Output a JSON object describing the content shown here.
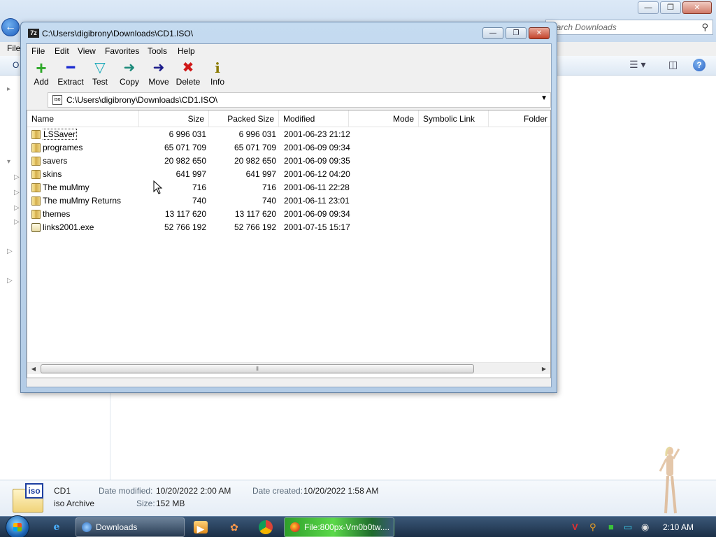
{
  "explorer": {
    "search_placeholder": "earch Downloads",
    "menu_file": "File",
    "organize": "O",
    "window_buttons": [
      "—",
      "❐",
      "✕"
    ],
    "details": {
      "name": "CD1",
      "type": "iso Archive",
      "modified_label": "Date modified:",
      "modified_value": "10/20/2022 2:00 AM",
      "created_label": "Date created:",
      "created_value": "10/20/2022 1:58 AM",
      "size_label": "Size:",
      "size_value": "152 MB",
      "icon_label": "iso"
    }
  },
  "zip": {
    "title": "C:\\Users\\digibrony\\Downloads\\CD1.ISO\\",
    "icon_text": "7z",
    "window_buttons": [
      "—",
      "❐",
      "✕"
    ],
    "menu": [
      "File",
      "Edit",
      "View",
      "Favorites",
      "Tools",
      "Help"
    ],
    "toolbar": [
      {
        "label": "Add",
        "icon": "add-icon",
        "glyph": "+",
        "color": "#2fa82a"
      },
      {
        "label": "Extract",
        "icon": "extract-icon",
        "glyph": "━",
        "color": "#1a2ad0"
      },
      {
        "label": "Test",
        "icon": "test-icon",
        "glyph": "▽",
        "color": "#18a8b8"
      },
      {
        "label": "Copy",
        "icon": "copy-icon",
        "glyph": "➜",
        "color": "#1c8a7a"
      },
      {
        "label": "Move",
        "icon": "move-icon",
        "glyph": "➜",
        "color": "#1a1a8a"
      },
      {
        "label": "Delete",
        "icon": "delete-icon",
        "glyph": "✖",
        "color": "#d01818"
      },
      {
        "label": "Info",
        "icon": "info-icon",
        "glyph": "i",
        "color": "#8a7a00"
      }
    ],
    "address_icon": "iso",
    "address_path": "C:\\Users\\digibrony\\Downloads\\CD1.ISO\\",
    "columns": [
      "Name",
      "Size",
      "Packed Size",
      "Modified",
      "Mode",
      "Symbolic Link",
      "Folder"
    ],
    "rows": [
      {
        "name": "LSSaver",
        "type": "folder",
        "size": "6 996 031",
        "packed": "6 996 031",
        "modified": "2001-06-23 21:12"
      },
      {
        "name": "programes",
        "type": "folder",
        "size": "65 071 709",
        "packed": "65 071 709",
        "modified": "2001-06-09 09:34"
      },
      {
        "name": "savers",
        "type": "folder",
        "size": "20 982 650",
        "packed": "20 982 650",
        "modified": "2001-06-09 09:35"
      },
      {
        "name": "skins",
        "type": "folder",
        "size": "641 997",
        "packed": "641 997",
        "modified": "2001-06-12 04:20"
      },
      {
        "name": "The muMmy",
        "type": "folder",
        "size": "716",
        "packed": "716",
        "modified": "2001-06-11 22:28"
      },
      {
        "name": "The muMmy Returns",
        "type": "folder",
        "size": "740",
        "packed": "740",
        "modified": "2001-06-11 23:01"
      },
      {
        "name": "themes",
        "type": "folder",
        "size": "13 117 620",
        "packed": "13 117 620",
        "modified": "2001-06-09 09:34"
      },
      {
        "name": "links2001.exe",
        "type": "exe",
        "size": "52 766 192",
        "packed": "52 766 192",
        "modified": "2001-07-15 15:17"
      }
    ],
    "scroll_thumb_glyph": "⦀"
  },
  "taskbar": {
    "buttons": [
      {
        "label": "Downloads",
        "icon": "explorer-icon"
      },
      {
        "label": "File:800px-Vm0b0tw....",
        "icon": "firefox-icon"
      }
    ],
    "clock": "2:10 AM",
    "tray_glyphs": [
      "V",
      "⚲",
      "■",
      "▭",
      "◉"
    ]
  }
}
